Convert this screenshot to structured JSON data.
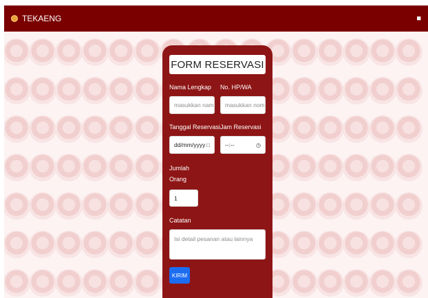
{
  "navbar": {
    "brand": "TEKAENG",
    "right_icon": "user-icon"
  },
  "form": {
    "title": "FORM RESERVASI",
    "name": {
      "label": "Nama Lengkap",
      "placeholder": "masukkan nama"
    },
    "phone": {
      "label": "No. HP/WA",
      "placeholder": "masukkan nomor"
    },
    "date": {
      "label": "Tanggal Reservasi",
      "placeholder": "dd/mm/yyyy",
      "icon": "calendar-icon"
    },
    "time": {
      "label": "Jam Reservasi",
      "placeholder": "--:--",
      "icon": "clock-icon"
    },
    "people": {
      "label_1": "Jumlah",
      "label_2": "Orang",
      "value": "1"
    },
    "notes": {
      "label": "Catatan",
      "placeholder": "Isi detail pesanan atau lainnya"
    },
    "submit": "KIRIM"
  },
  "colors": {
    "navbar": "#7a0000",
    "card": "#8e1515",
    "button": "#1d6df2"
  }
}
